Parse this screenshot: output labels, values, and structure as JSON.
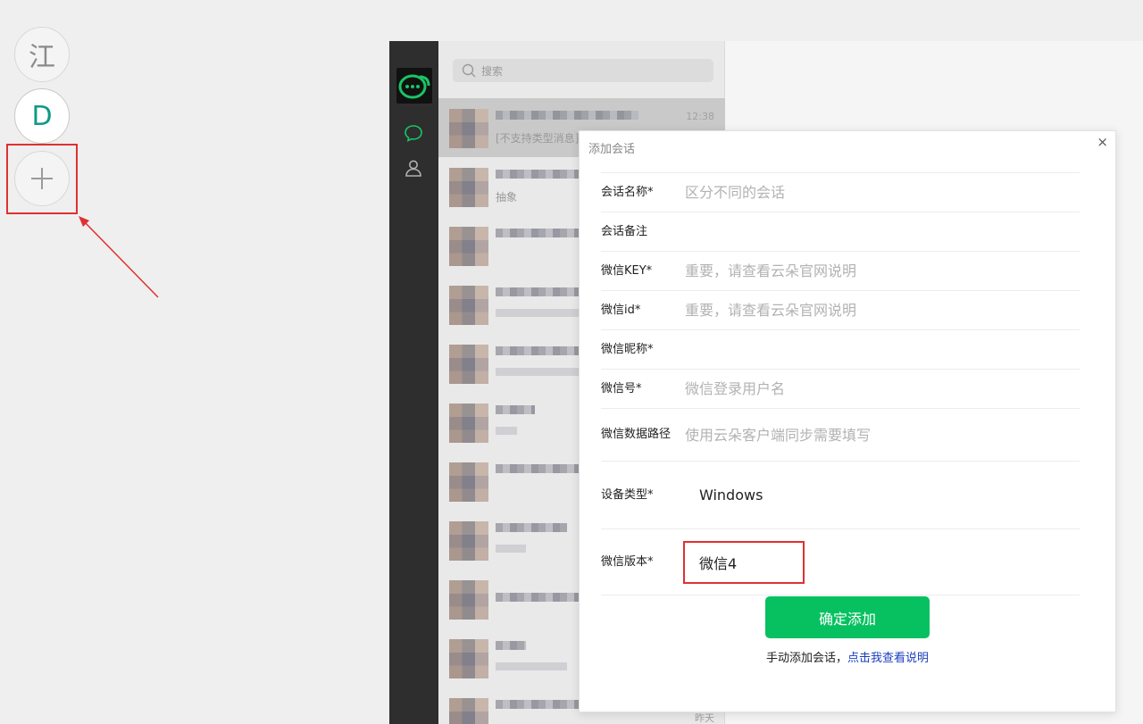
{
  "accounts": [
    {
      "label": "江"
    },
    {
      "label": "D"
    }
  ],
  "sidebar": {
    "search_placeholder": "搜索"
  },
  "chats": [
    {
      "time": "12:38",
      "preview": "[不支持类型消息]"
    },
    {
      "time": "",
      "preview": "抽象"
    },
    {
      "time": "",
      "preview": ""
    },
    {
      "time": "",
      "preview": ""
    },
    {
      "time": "",
      "preview": ""
    },
    {
      "time": "",
      "preview": ""
    },
    {
      "time": "",
      "preview": ""
    },
    {
      "time": "",
      "preview": ""
    },
    {
      "time": "",
      "preview": ""
    },
    {
      "time": "",
      "preview": ""
    },
    {
      "time": "昨天",
      "preview": ""
    }
  ],
  "modal": {
    "title": "添加会话",
    "close": "×",
    "fields": {
      "session_name": {
        "label": "会话名称*",
        "placeholder": "区分不同的会话"
      },
      "session_note": {
        "label": "会话备注",
        "placeholder": ""
      },
      "wechat_key": {
        "label": "微信KEY*",
        "placeholder": "重要，请查看云朵官网说明"
      },
      "wechat_id": {
        "label": "微信id*",
        "placeholder": "重要，请查看云朵官网说明"
      },
      "wechat_nickname": {
        "label": "微信昵称*",
        "placeholder": ""
      },
      "wechat_account": {
        "label": "微信号*",
        "placeholder": "微信登录用户名"
      },
      "wechat_data_path": {
        "label": "微信数据路径",
        "placeholder": "使用云朵客户端同步需要填写"
      },
      "device_type": {
        "label": "设备类型*",
        "value": "Windows"
      },
      "wechat_version": {
        "label": "微信版本*",
        "value": "微信4"
      }
    },
    "submit_label": "确定添加",
    "help_text": "手动添加会话，",
    "help_link": "点击我查看说明"
  },
  "colors": {
    "accent": "#07c160",
    "highlight": "#e03030",
    "link": "#1a3ebf"
  }
}
